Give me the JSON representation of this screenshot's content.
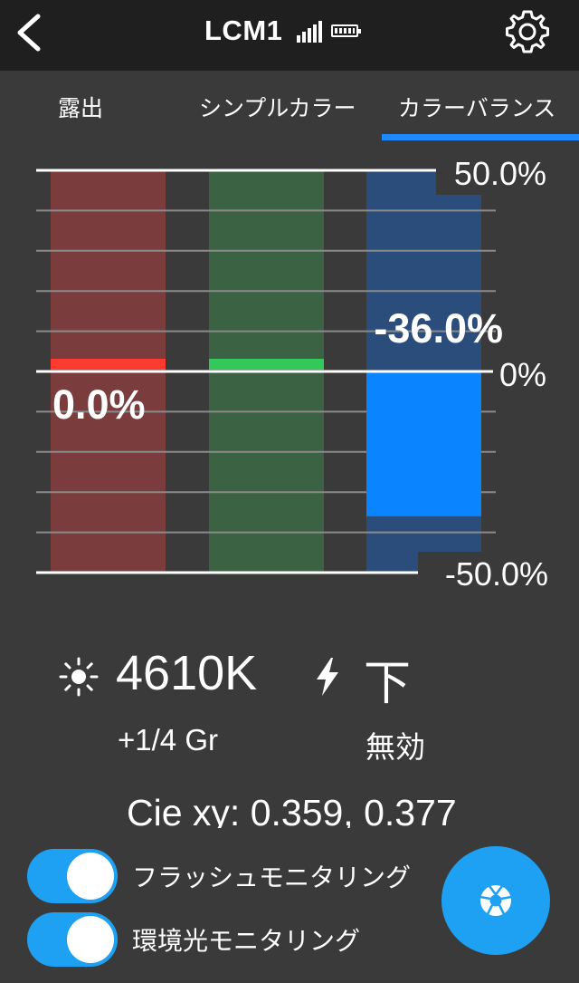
{
  "header": {
    "title": "LCM1"
  },
  "tabs": [
    {
      "label": "露出",
      "active": false
    },
    {
      "label": "シンプルカラー",
      "active": false
    },
    {
      "label": "カラーバランス",
      "active": true
    }
  ],
  "chart_data": {
    "type": "bar",
    "categories": [
      "R",
      "G",
      "B"
    ],
    "values": [
      0.0,
      0.0,
      -36.0
    ],
    "series_colors": {
      "R": "#ff3b30",
      "G": "#34c759",
      "B": "#0a84ff"
    },
    "track_colors": [
      "#7a3c3c",
      "#3b6343",
      "#2b4d7c"
    ],
    "ylim": [
      -50,
      50
    ],
    "y_tick_labels": {
      "top": "50.0%",
      "mid": "0%",
      "bottom": "-50.0%"
    },
    "data_labels": [
      "0.0%",
      "-36.0%"
    ],
    "grid": true
  },
  "readouts": {
    "color_temp": "4610K",
    "tint": "+1/4 Gr",
    "flash_direction": "下",
    "flash_state": "無効",
    "cie_xy": "Cie xy: 0.359, 0.377"
  },
  "toggles": [
    {
      "label": "フラッシュモニタリング",
      "on": true
    },
    {
      "label": "環境光モニタリング",
      "on": true
    }
  ],
  "colors": {
    "accent": "#1ea1f2",
    "tab_underline": "#1e88ff",
    "header_bg": "#1f1f1f",
    "page_bg": "#3a3a3a"
  },
  "icons": {
    "back": "chevron-left-icon",
    "settings": "gear-icon",
    "sun": "sun-icon",
    "flash": "bolt-icon",
    "measure": "shutter-icon"
  }
}
